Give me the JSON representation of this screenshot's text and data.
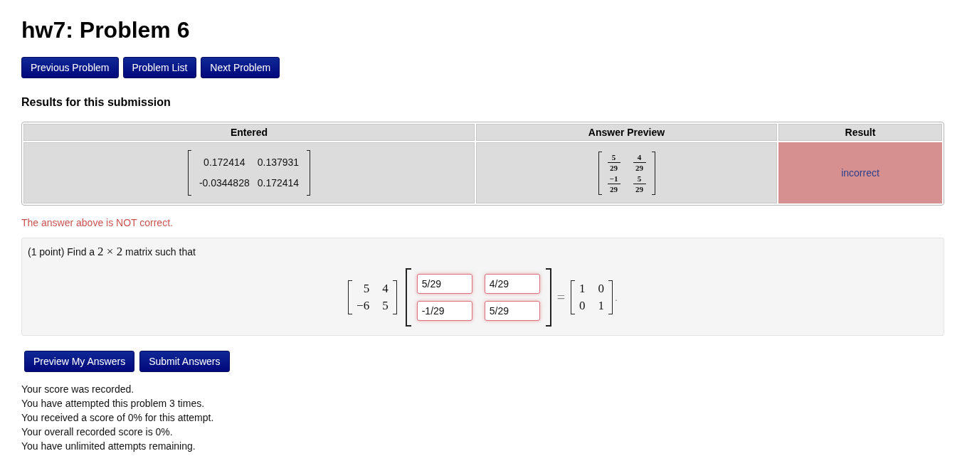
{
  "title": "hw7: Problem 6",
  "nav_buttons": [
    {
      "label": "Previous Problem"
    },
    {
      "label": "Problem List"
    },
    {
      "label": "Next Problem"
    }
  ],
  "results": {
    "heading": "Results for this submission",
    "columns": [
      "Entered",
      "Answer Preview",
      "Result"
    ],
    "rows": [
      {
        "entered": [
          [
            "0.172414",
            "0.137931"
          ],
          [
            "-0.0344828",
            "0.172414"
          ]
        ],
        "preview": [
          [
            {
              "numerator": "5",
              "denominator": "29"
            },
            {
              "numerator": "4",
              "denominator": "29"
            }
          ],
          [
            {
              "numerator": "−1",
              "denominator": "29"
            },
            {
              "numerator": "5",
              "denominator": "29"
            }
          ]
        ],
        "result": "incorrect",
        "correct": false
      }
    ]
  },
  "feedback": "The answer above is NOT correct.",
  "problem": {
    "prompt": [
      {
        "kind": "text",
        "text": "(1 point) Find a"
      },
      {
        "kind": "math",
        "text": "2 × 2"
      },
      {
        "kind": "text",
        "text": "matrix such that"
      }
    ],
    "equation": {
      "left_matrix": [
        [
          "5",
          "4"
        ],
        [
          "−6",
          "5"
        ]
      ],
      "answers": [
        [
          {
            "value": "5/29",
            "correct": false
          },
          {
            "value": "4/29",
            "correct": false
          }
        ],
        [
          {
            "value": "-1/29",
            "correct": false
          },
          {
            "value": "5/29",
            "correct": false
          }
        ]
      ],
      "relation": "=",
      "right_matrix": [
        [
          "1",
          "0"
        ],
        [
          "0",
          "1"
        ]
      ],
      "end_mark": "."
    }
  },
  "actions": [
    {
      "label": "Preview My Answers"
    },
    {
      "label": "Submit Answers"
    }
  ],
  "messages": [
    "Your score was recorded.",
    "You have attempted this problem 3 times.",
    "You received a score of 0% for this attempt.",
    "Your overall recorded score is 0%.",
    "You have unlimited attempts remaining."
  ]
}
